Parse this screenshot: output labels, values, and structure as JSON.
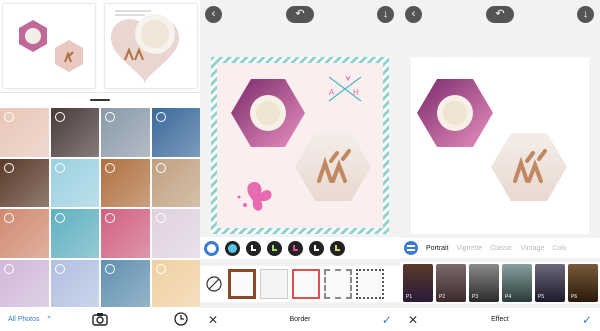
{
  "gallery": {
    "album_label": "All Photos",
    "chevron": "^",
    "cell_colors": [
      [
        "#e8c6b8",
        "#4a3a3a",
        "#8a9aa8",
        "#3a6a9a"
      ],
      [
        "#5a3a2a",
        "#9ad0e0",
        "#b07040",
        "#c0a080"
      ],
      [
        "#d08a70",
        "#60b0c0",
        "#d06080",
        "#e0d0e0"
      ],
      [
        "#d0b8d8",
        "#b0c0e0",
        "#6090b0",
        "#f0d0a0"
      ]
    ]
  },
  "border_screen": {
    "tool_label": "Border",
    "cancel": "✕",
    "confirm": "✓"
  },
  "effect_screen": {
    "tool_label": "Effect",
    "cancel": "✕",
    "confirm": "✓",
    "tabs": [
      "Portrait",
      "Vignette",
      "Classic",
      "Vintage",
      "Colo"
    ],
    "thumbs": [
      "P1",
      "P2",
      "P3",
      "P4",
      "P5",
      "P6"
    ]
  },
  "colors": {
    "accent": "#3a7bd5",
    "button_bg": "#555555",
    "border_stripe_a": "#8ed2cf",
    "border_stripe_b": "#ffffff"
  }
}
